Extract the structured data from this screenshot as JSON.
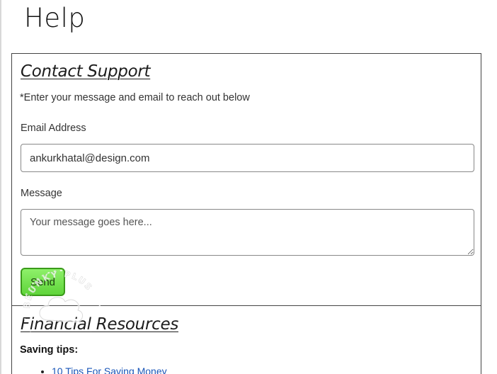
{
  "page": {
    "title": "Help"
  },
  "contact": {
    "title": "Contact Support",
    "intro": "*Enter your message and email to reach out below",
    "email_label": "Email Address",
    "email_value": "ankurkhatal@design.com",
    "message_label": "Message",
    "message_placeholder": "Your message goes here...",
    "send_label": "Send"
  },
  "resources": {
    "title": "Financial Resources",
    "saving_tips_label": "Saving tips:",
    "links": [
      {
        "label": "10 Tips For Saving Money"
      }
    ]
  },
  "watermark": {
    "text": "BEUNKY PLUS"
  },
  "colors": {
    "send_button": "#6ee04a",
    "link": "#1a56b8",
    "border": "#444444"
  }
}
